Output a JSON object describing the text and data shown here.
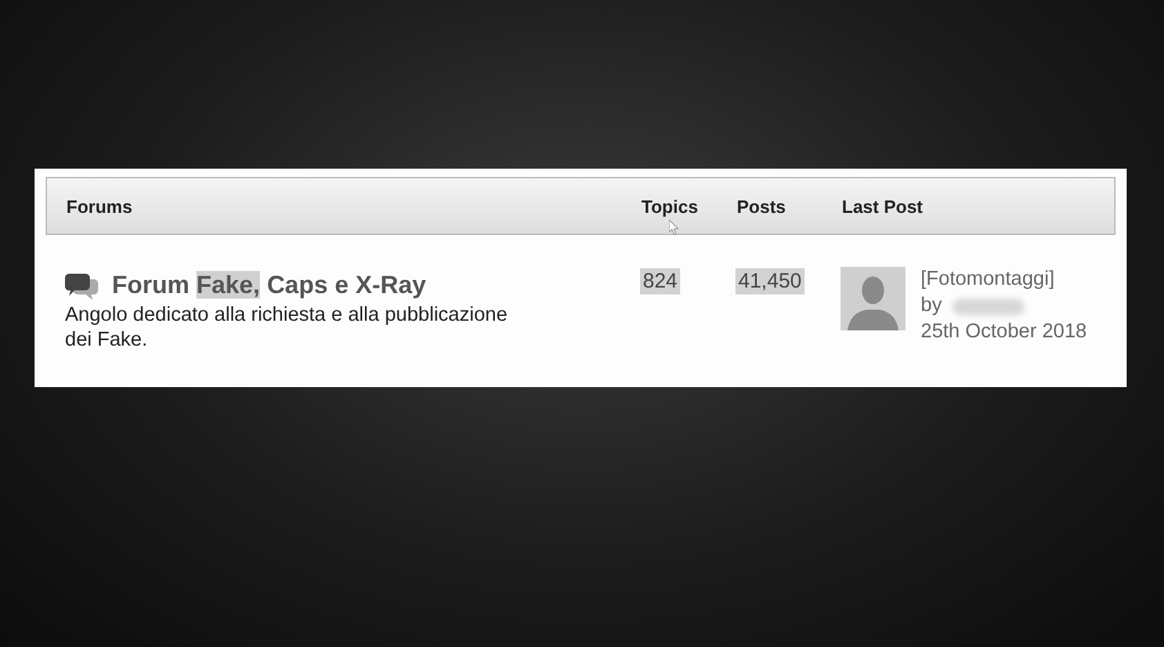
{
  "table": {
    "columns": [
      {
        "label": "Forums"
      },
      {
        "label": "Topics"
      },
      {
        "label": "Posts"
      },
      {
        "label": "Last Post"
      }
    ],
    "rows": [
      {
        "title": {
          "before": "Forum",
          "highlighted_word": "Fake,",
          "after": "Caps e X-Ray"
        },
        "description": "Angolo dedicato alla richiesta e alla pubblicazione dei Fake.",
        "topics": {
          "text": "824",
          "highlighted": true
        },
        "posts": {
          "text": "41,450",
          "highlighted": true
        },
        "last_post": {
          "forum": "[Fotomontaggi]",
          "by": "by",
          "author_blurred": true,
          "date": "25th October 2018"
        }
      }
    ]
  }
}
